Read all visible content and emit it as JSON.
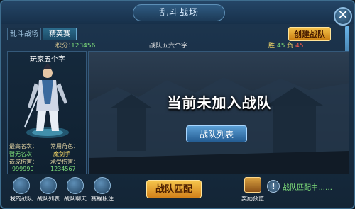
{
  "window": {
    "title": "乱斗战场",
    "close_symbol": "✕"
  },
  "tabs": [
    {
      "label": "乱斗战场",
      "active": false
    },
    {
      "label": "精英赛",
      "active": true
    }
  ],
  "actions": {
    "create_team": "创建战队",
    "team_list": "战队列表",
    "team_match": "战队匹配"
  },
  "stats": {
    "score_label": "积分：",
    "score_value": "123456",
    "team_name": "战队五六个字",
    "win_label": "胜",
    "win_value": "45",
    "lose_label": "负",
    "lose_value": "45"
  },
  "player": {
    "name": "玩家五个字",
    "highest_title_label": "最高名次：",
    "highest_title_value": "暂无名次",
    "common_role_label": "常用角色：",
    "common_role_value": "魔剑手",
    "damage_dealt_label": "造成伤害：",
    "damage_dealt_value": "999999",
    "damage_taken_label": "承受伤害：",
    "damage_taken_value": "1234567"
  },
  "main": {
    "message": "当前未加入战队"
  },
  "bottom_buttons": [
    {
      "label": "我的战队",
      "icon": "team-icon"
    },
    {
      "label": "战队列表",
      "icon": "list-icon"
    },
    {
      "label": "战队聊天",
      "icon": "chat-icon"
    },
    {
      "label": "赛程段注",
      "icon": "trophy-icon"
    }
  ],
  "reward": {
    "label": "奖励预览",
    "icon": "treasure-chest-icon"
  },
  "status": {
    "text": "战队匹配中……",
    "icon": "exclamation-icon"
  },
  "colors": {
    "green": "#7fe07a",
    "gold": "#ffe06a",
    "red": "#ff5a4a",
    "accent_orange": "#d2801a",
    "accent_blue": "#245c92"
  }
}
